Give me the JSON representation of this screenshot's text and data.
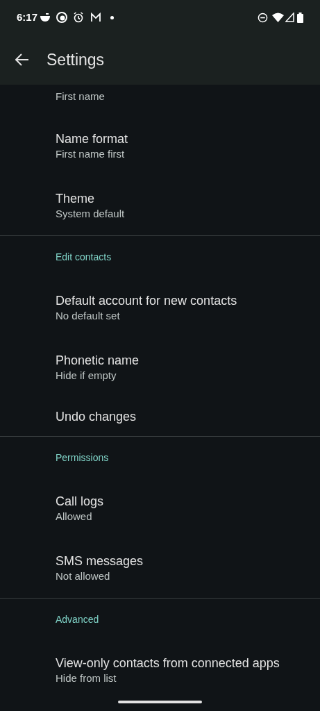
{
  "status_bar": {
    "time": "6:17"
  },
  "app_bar": {
    "title": "Settings"
  },
  "sections": [
    {
      "items": [
        {
          "summary": "First name"
        },
        {
          "title": "Name format",
          "summary": "First name first"
        },
        {
          "title": "Theme",
          "summary": "System default"
        }
      ]
    },
    {
      "header": "Edit contacts",
      "items": [
        {
          "title": "Default account for new contacts",
          "summary": "No default set"
        },
        {
          "title": "Phonetic name",
          "summary": "Hide if empty"
        },
        {
          "title": "Undo changes"
        }
      ]
    },
    {
      "header": "Permissions",
      "items": [
        {
          "title": "Call logs",
          "summary": "Allowed"
        },
        {
          "title": "SMS messages",
          "summary": "Not allowed"
        }
      ]
    },
    {
      "header": "Advanced",
      "items": [
        {
          "title": "View-only contacts from connected apps",
          "summary": "Hide from list"
        }
      ]
    }
  ]
}
